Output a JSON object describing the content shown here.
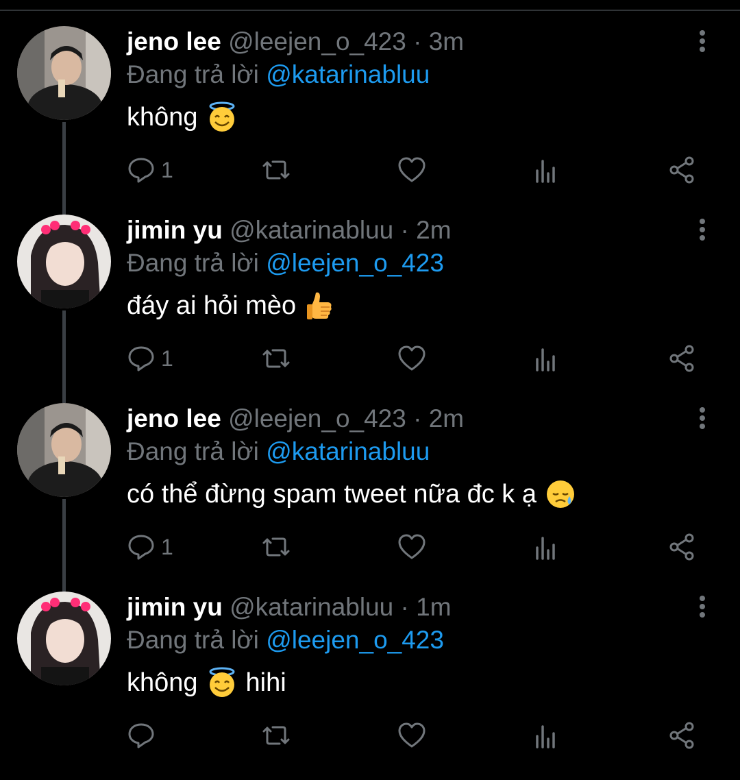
{
  "thread": {
    "replying_prefix": "Đang trả lời",
    "tweets": [
      {
        "name": "jeno lee",
        "handle": "@leejen_o_423",
        "dot": "·",
        "time": "3m",
        "replying_to": "@katarinabluu",
        "text": "không",
        "text_after": "",
        "emoji": "smiling-halo-emoji",
        "reply_count": "1",
        "avatar": "jeno-avatar"
      },
      {
        "name": "jimin yu",
        "handle": "@katarinabluu",
        "dot": "·",
        "time": "2m",
        "replying_to": "@leejen_o_423",
        "text": "đáy ai hỏi mèo",
        "text_after": "",
        "emoji": "thumbs-up-emoji",
        "reply_count": "1",
        "avatar": "jimin-avatar"
      },
      {
        "name": "jeno lee",
        "handle": "@leejen_o_423",
        "dot": "·",
        "time": "2m",
        "replying_to": "@katarinabluu",
        "text": "có thể đừng spam tweet nữa đc k ạ",
        "text_after": "",
        "emoji": "sad-sweat-emoji",
        "reply_count": "1",
        "avatar": "jeno-avatar"
      },
      {
        "name": "jimin yu",
        "handle": "@katarinabluu",
        "dot": "·",
        "time": "1m",
        "replying_to": "@leejen_o_423",
        "text": "không",
        "text_after": "hihi",
        "emoji": "smiling-halo-emoji",
        "reply_count": "",
        "avatar": "jimin-avatar"
      }
    ]
  },
  "colors": {
    "background": "#000000",
    "name": "#ffffff",
    "muted": "#71767b",
    "mention": "#1d9bf0",
    "thread_line": "#3a3f44"
  }
}
